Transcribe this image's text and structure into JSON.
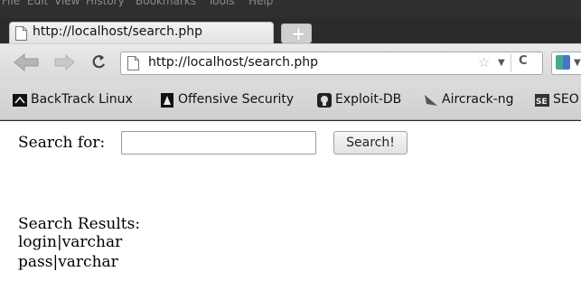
{
  "menu": [
    "File",
    "Edit",
    "View",
    "History",
    "Bookmarks",
    "Tools",
    "Help"
  ],
  "tab": {
    "title": "http://localhost/search.php",
    "new_tab_label": "+"
  },
  "navbar": {
    "url": "http://localhost/search.php"
  },
  "bookmarks": [
    {
      "label": "BackTrack Linux",
      "icon": "backtrack-icon"
    },
    {
      "label": "Offensive Security",
      "icon": "offensive-security-icon"
    },
    {
      "label": "Exploit-DB",
      "icon": "exploit-db-icon"
    },
    {
      "label": "Aircrack-ng",
      "icon": "aircrack-icon"
    },
    {
      "label": "SEO",
      "icon": "seo-icon"
    }
  ],
  "form": {
    "label": "Search for:",
    "value": "",
    "button": "Search!"
  },
  "results": {
    "title": "Search Results:",
    "rows": [
      "login|varchar",
      "pass|varchar"
    ]
  }
}
